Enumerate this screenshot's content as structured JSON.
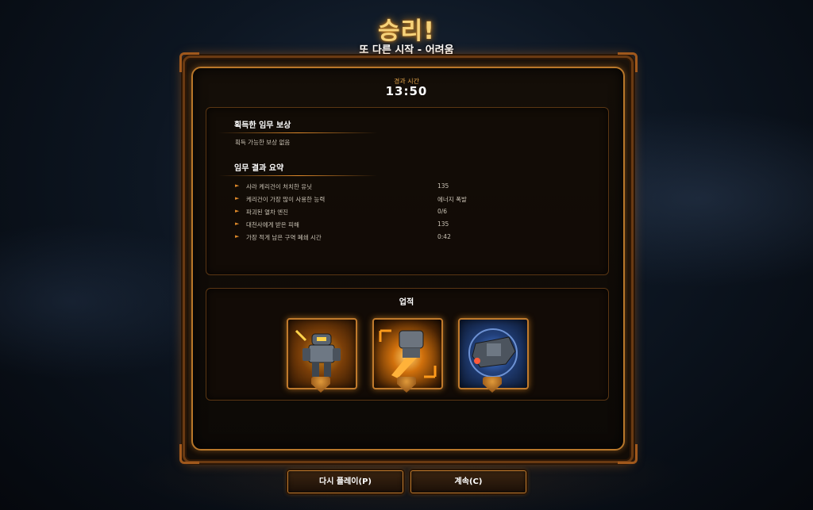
{
  "header": {
    "title": "승리!",
    "subtitle": "또 다른 시작 - 어려움"
  },
  "time": {
    "label": "경과 시간",
    "value": "13:50"
  },
  "rewards": {
    "heading": "획득한 임무 보상",
    "empty_text": "획득 가능한 보상 없음"
  },
  "summary": {
    "heading": "임무 결과 요약",
    "rows": [
      {
        "label": "사라 케리건이 처치한 유닛",
        "value": "135"
      },
      {
        "label": "케리건이 가장 많이 사용한 능력",
        "value": "에너지 폭발"
      },
      {
        "label": "파괴된 열차 엔진",
        "value": "0/6"
      },
      {
        "label": "대천사에게 받은 피해",
        "value": "135"
      },
      {
        "label": "가장 적게 남은 구역 폐쇄 시간",
        "value": "0:42"
      }
    ]
  },
  "achievements": {
    "heading": "업적",
    "items": [
      {
        "icon": "marine-achievement-icon"
      },
      {
        "icon": "thruster-achievement-icon"
      },
      {
        "icon": "battlecruiser-achievement-icon"
      }
    ]
  },
  "buttons": {
    "replay": "다시 플레이(P)",
    "continue": "계속(C)"
  },
  "colors": {
    "accent": "#e08a2a",
    "title_glow": "#f5d27a",
    "frame": "#b8772a"
  }
}
